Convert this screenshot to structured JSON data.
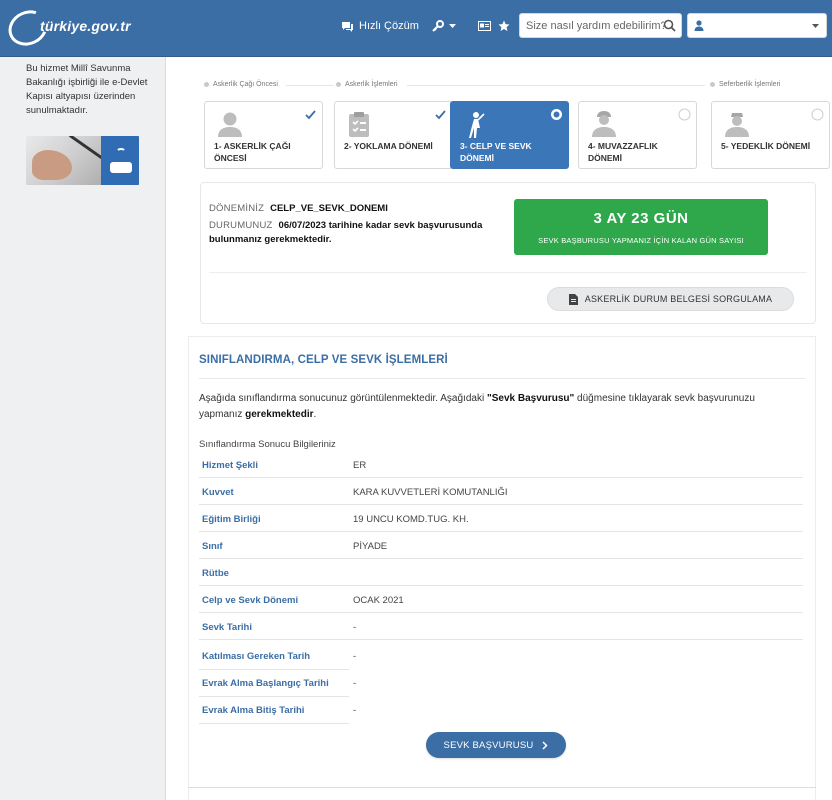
{
  "header": {
    "logo_text": "türkiye.gov.tr",
    "quick_solution": "Hızlı Çözüm",
    "search_placeholder": "Size nasıl yardım edebilirim?",
    "user_name": ""
  },
  "sidebar": {
    "note": "Bu hizmet Millî Savunma Bakanlığı işbirliği ile e-Devlet Kapısı altyapısı üzerinden sunulmaktadır."
  },
  "phases": {
    "pre": "Askerlik Çağı Öncesi",
    "ops": "Askerlik İşlemleri",
    "mob": "Seferberlik İşlemleri"
  },
  "steps": [
    {
      "label": "1- ASKERLİK ÇAĞI ÖNCESİ",
      "state": "done"
    },
    {
      "label": "2- YOKLAMA DÖNEMİ",
      "state": "done"
    },
    {
      "label": "3- CELP VE SEVK DÖNEMİ",
      "state": "active"
    },
    {
      "label": "4- MUVAZZAFLIK DÖNEMİ",
      "state": "pending"
    },
    {
      "label": "5- YEDEKLİK DÖNEMİ",
      "state": "pending"
    }
  ],
  "status": {
    "period_key": "DÖNEMİNİZ",
    "period_value": "CELP_VE_SEVK_DONEMI",
    "state_key": "DURUMUNUZ",
    "state_value": "06/07/2023 tarihine kadar sevk başvurusunda bulunmanız gerekmektedir.",
    "countdown": "3 AY 23 GÜN",
    "countdown_caption": "SEVK BAŞBURUSU YAPMANIZ İÇİN KALAN GÜN SAYISI",
    "doc_button": "ASKERLİK DURUM BELGESİ SORGULAMA"
  },
  "section": {
    "title": "SINIFLANDIRMA, CELP VE SEVK İŞLEMLERİ",
    "desc_1": "Aşağıda sınıflandırma sonucunuz görüntülenmektedir. Aşağıdaki ",
    "desc_bold": "\"Sevk Başvurusu\"",
    "desc_2": " düğmesine tıklayarak sevk başvurunuzu yapmanız ",
    "desc_bold2": "gerekmektedir",
    "desc_end": ".",
    "info_title": "Sınıflandırma Sonucu Bilgileriniz",
    "rows": [
      {
        "key": "Hizmet Şekli",
        "value": "ER"
      },
      {
        "key": "Kuvvet",
        "value": "KARA KUVVETLERİ KOMUTANLIĞI"
      },
      {
        "key": "Eğitim Birliği",
        "value": "19 UNCU KOMD.TUG. KH."
      },
      {
        "key": "Sınıf",
        "value": "PİYADE"
      },
      {
        "key": "Rütbe",
        "value": ""
      },
      {
        "key": "Celp ve Sevk Dönemi",
        "value": "OCAK 2021"
      },
      {
        "key": "Sevk Tarihi",
        "value": "-"
      },
      {
        "key": "Katılması Gereken Tarih",
        "value": "-"
      },
      {
        "key": "Evrak Alma Başlangıç Tarihi",
        "value": "-"
      },
      {
        "key": "Evrak Alma Bitiş Tarihi",
        "value": "-"
      }
    ],
    "submit_button": "SEVK BAŞVURUSU"
  },
  "colors": {
    "header": "#3b6ea5",
    "active_step": "#3b76b8",
    "countdown": "#2ea84a",
    "accent_text": "#3b6ea5"
  }
}
